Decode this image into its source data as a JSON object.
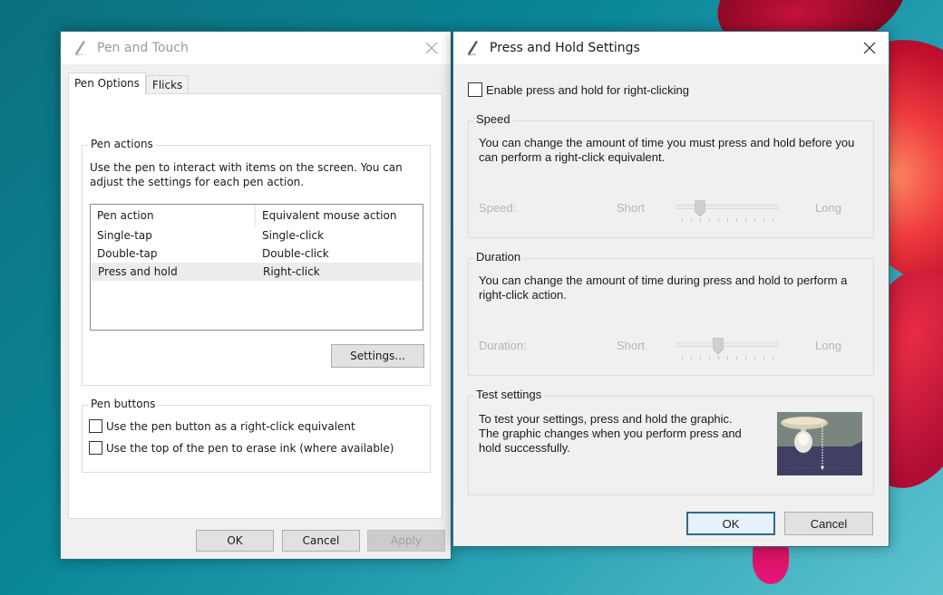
{
  "pen_touch": {
    "title": "Pen and Touch",
    "tabs": [
      {
        "label": "Pen Options",
        "active": true
      },
      {
        "label": "Flicks",
        "active": false
      }
    ],
    "pen_actions": {
      "legend": "Pen actions",
      "description": "Use the pen to interact with items on the screen.  You can adjust the settings for each pen action.",
      "columns": [
        "Pen action",
        "Equivalent mouse action"
      ],
      "rows": [
        {
          "action": "Single-tap",
          "mouse": "Single-click",
          "selected": false
        },
        {
          "action": "Double-tap",
          "mouse": "Double-click",
          "selected": false
        },
        {
          "action": "Press and hold",
          "mouse": "Right-click",
          "selected": true
        }
      ],
      "settings_button": "Settings..."
    },
    "pen_buttons": {
      "legend": "Pen buttons",
      "options": [
        {
          "label": "Use the pen button as a right-click equivalent",
          "checked": false
        },
        {
          "label": "Use the top of the pen to erase ink (where available)",
          "checked": false
        }
      ]
    },
    "buttons": {
      "ok": "OK",
      "cancel": "Cancel",
      "apply": "Apply"
    }
  },
  "press_hold": {
    "title": "Press and Hold Settings",
    "enable": {
      "label": "Enable press and hold for right-clicking",
      "checked": false
    },
    "speed": {
      "legend": "Speed",
      "description": "You can change the amount of time you must press and hold before you can perform a right-click equivalent.",
      "label": "Speed:",
      "min_label": "Short",
      "max_label": "Long",
      "value": 2,
      "tick_count": 11
    },
    "duration": {
      "legend": "Duration",
      "description": "You can change the amount of time during press and hold to perform a right-click action.",
      "label": "Duration:",
      "min_label": "Short",
      "max_label": "Long",
      "value": 4,
      "tick_count": 11
    },
    "test": {
      "legend": "Test settings",
      "description": "To test your settings, press and hold the graphic. The graphic changes when you perform press and hold successfully."
    },
    "buttons": {
      "ok": "OK",
      "cancel": "Cancel"
    }
  }
}
